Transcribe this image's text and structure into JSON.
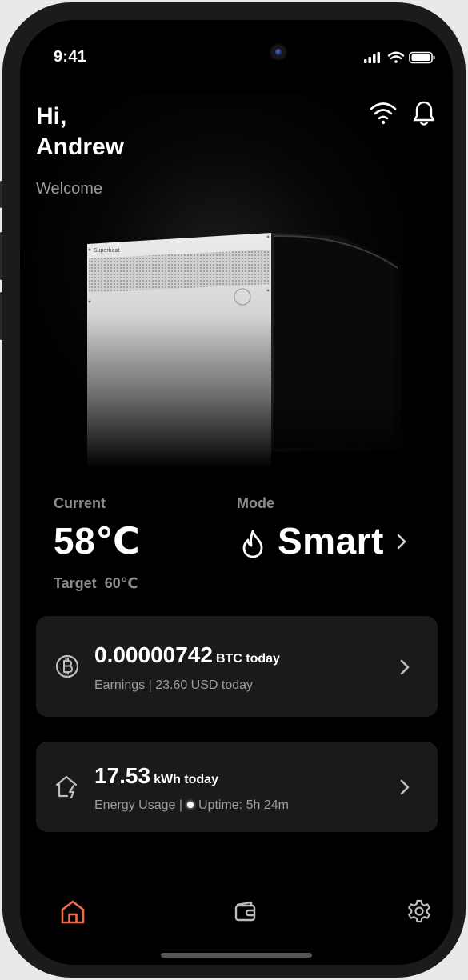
{
  "status_bar": {
    "time": "9:41"
  },
  "header": {
    "greeting": "Hi,",
    "name": "Andrew",
    "subtitle": "Welcome"
  },
  "device": {
    "brand": "Superheat"
  },
  "current": {
    "label": "Current",
    "value": "58℃",
    "target_label": "Target",
    "target_value": "60℃"
  },
  "mode": {
    "label": "Mode",
    "value": "Smart"
  },
  "earnings_card": {
    "amount": "0.00000742",
    "unit": "BTC today",
    "subtitle": "Earnings | 23.60 USD today"
  },
  "energy_card": {
    "amount": "17.53",
    "unit": "kWh today",
    "usage": "Energy Usage |",
    "uptime": "Uptime: 5h 24m"
  },
  "colors": {
    "accent": "#f26b4a",
    "background": "#000000",
    "card": "#1a1a1a",
    "muted": "#8b8b8b"
  },
  "icons": [
    "wifi-icon",
    "bell-icon",
    "flame-icon",
    "bitcoin-icon",
    "home-energy-icon",
    "home-icon",
    "wallet-icon",
    "gear-icon"
  ]
}
